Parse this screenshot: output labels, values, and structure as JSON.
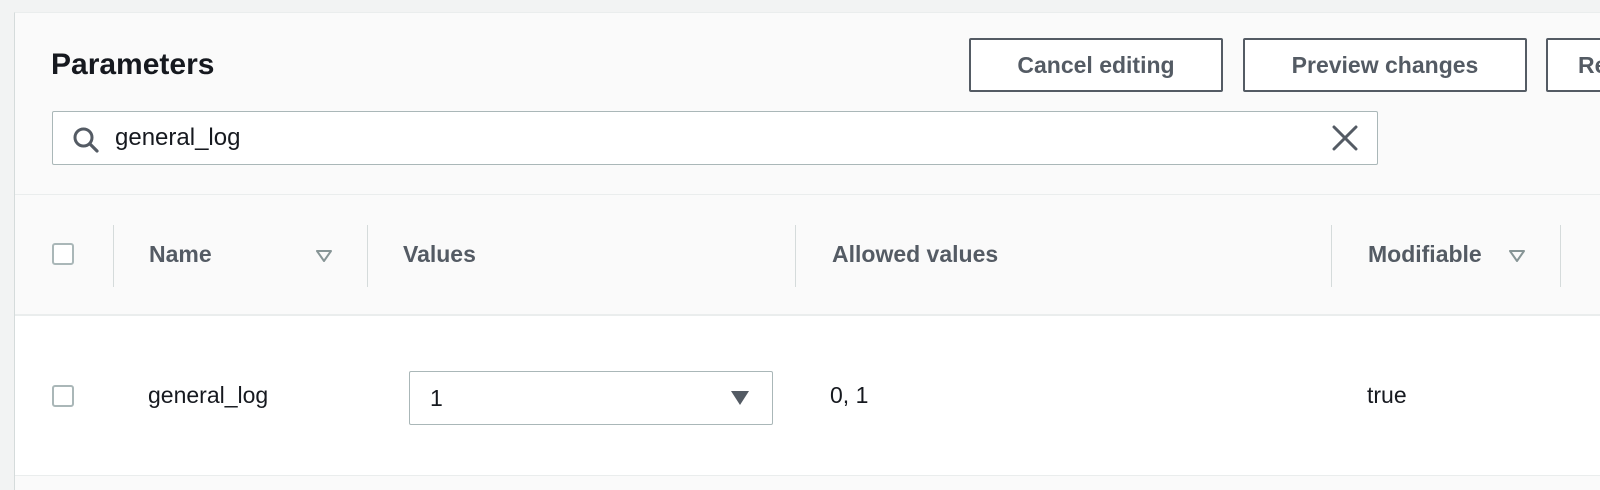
{
  "header": {
    "title": "Parameters",
    "buttons": {
      "cancel_label": "Cancel editing",
      "preview_label": "Preview changes",
      "reset_label": "Re"
    }
  },
  "search": {
    "value": "general_log",
    "icon": "search-icon",
    "clear_icon": "close-icon"
  },
  "table": {
    "columns": {
      "name": "Name",
      "values": "Values",
      "allowed_values": "Allowed values",
      "modifiable": "Modifiable"
    },
    "rows": [
      {
        "name": "general_log",
        "value": "1",
        "allowed_values": "0, 1",
        "modifiable": "true",
        "selected": false
      }
    ]
  },
  "colors": {
    "panel_bg": "#fafafa",
    "border": "#aab7b8",
    "heading_text": "#16191f",
    "secondary_text": "#545b64"
  }
}
